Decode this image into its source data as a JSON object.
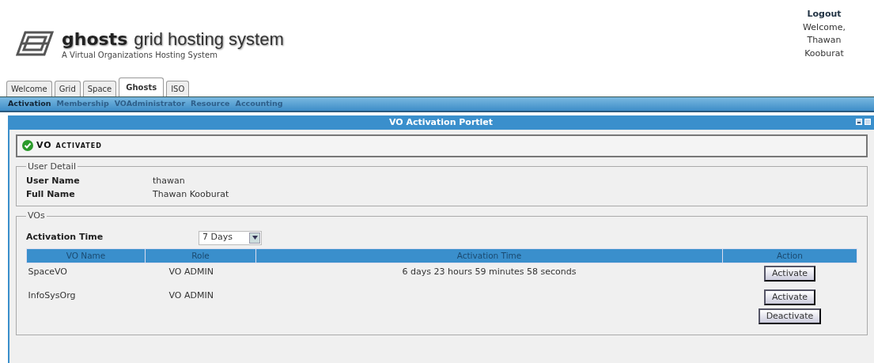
{
  "header": {
    "brand": "ghosts",
    "title": "grid hosting system",
    "subtitle": "A Virtual Organizations Hosting System",
    "logout": "Logout",
    "welcome": "Welcome, Thawan Kooburat"
  },
  "tabs": [
    {
      "label": "Welcome",
      "selected": false
    },
    {
      "label": "Grid",
      "selected": false
    },
    {
      "label": "Space",
      "selected": false
    },
    {
      "label": "Ghosts",
      "selected": true
    },
    {
      "label": "ISO",
      "selected": false
    }
  ],
  "subnav": [
    {
      "label": "Activation",
      "selected": true
    },
    {
      "label": "Membership",
      "selected": false
    },
    {
      "label": "VOAdministrator",
      "selected": false
    },
    {
      "label": "Resource",
      "selected": false
    },
    {
      "label": "Accounting",
      "selected": false
    }
  ],
  "portlet": {
    "title": "VO Activation Portlet",
    "status": "VO activated",
    "user_detail": {
      "legend": "User Detail",
      "fields": [
        {
          "label": "User Name",
          "value": "thawan"
        },
        {
          "label": "Full Name",
          "value": "Thawan Kooburat"
        }
      ]
    },
    "vos": {
      "legend": "VOs",
      "activation_label": "Activation Time",
      "activation_value": "7 Days",
      "columns": [
        "VO Name",
        "Role",
        "Activation Time",
        "Action"
      ],
      "rows": [
        {
          "name": "SpaceVO",
          "role": "VO ADMIN",
          "time": "6 days 23 hours 59 minutes 58 seconds",
          "actions": [
            "Activate"
          ]
        },
        {
          "name": "InfoSysOrg",
          "role": "VO ADMIN",
          "actions": [
            "Activate",
            "Deactivate"
          ]
        }
      ]
    }
  }
}
